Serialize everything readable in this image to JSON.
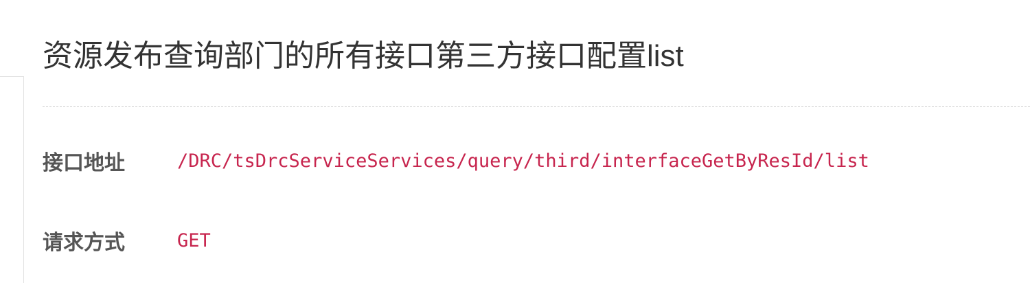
{
  "title": "资源发布查询部门的所有接口第三方接口配置list",
  "fields": [
    {
      "label": "接口地址",
      "value": "/DRC/tsDrcServiceServices/query/third/interfaceGetByResId/list"
    },
    {
      "label": "请求方式",
      "value": "GET"
    }
  ],
  "colors": {
    "code": "#c7254e",
    "label": "#555555",
    "title": "#333333"
  }
}
